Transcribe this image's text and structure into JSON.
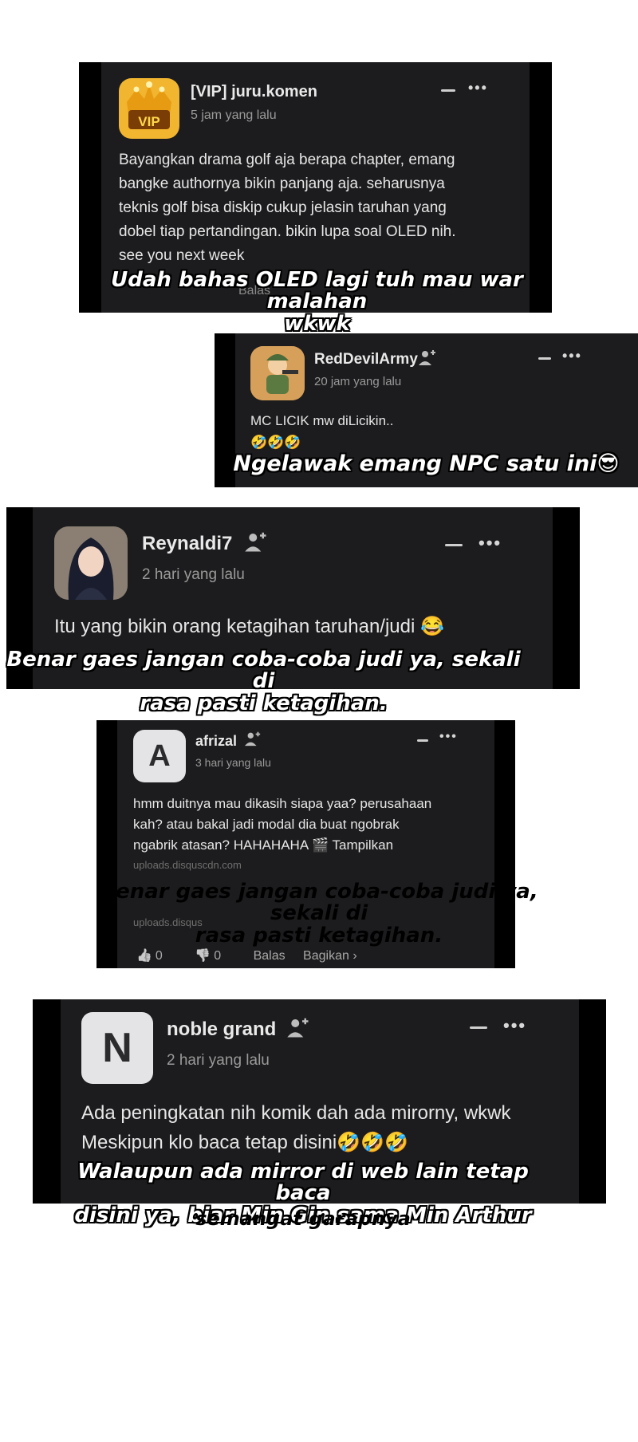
{
  "comments": [
    {
      "username": "[VIP] juru.komen",
      "time": "5 jam yang lalu",
      "text": "Bayangkan drama golf aja berapa chapter, emang\nbangke authornya bikin panjang aja. seharusnya\nteknis golf bisa diskip cukup jelasin taruhan yang\ndobel tiap pertandingan. bikin lupa soal OLED nih.\nsee you next week",
      "avatar_text": "VIP",
      "partial_action": "Balas",
      "caption": "Udah bahas OLED lagi tuh mau war malahan\nwkwk"
    },
    {
      "username": "RedDevilArmy",
      "time": "20 jam yang lalu",
      "text": "MC LICIK mw diLicikin..\n🤣🤣🤣",
      "caption": "Ngelawak emang NPC satu ini😎"
    },
    {
      "username": "Reynaldi7",
      "time": "2 hari yang lalu",
      "text": "Itu yang bikin orang ketagihan taruhan/judi 😂",
      "caption": "Benar gaes jangan coba-coba judi ya, sekali di\nrasa pasti ketagihan."
    },
    {
      "username": "afrizal",
      "time": "3 hari yang lalu",
      "avatar_letter": "A",
      "text": "hmm duitnya mau dikasih siapa yaa? perusahaan\nkah? atau bakal jadi modal dia buat ngobrak\nngabrik atasan? HAHAHAHA 🎬 Tampilkan",
      "link1": "uploads.disquscdn.com",
      "link2": "uploads.disqus",
      "caption": "Benar gaes jangan coba-coba judi ya, sekali di\nrasa pasti ketagihan.",
      "actions": {
        "like_count": "0",
        "dislike_count": "0",
        "reply": "Balas",
        "share": "Bagikan ›"
      }
    },
    {
      "username": "noble grand",
      "time": "2 hari yang lalu",
      "avatar_letter": "N",
      "text": "Ada peningkatan nih komik dah ada mirorny, wkwk\nMeskipun klo baca tetap disini🤣🤣🤣",
      "caption": "Walaupun ada mirror di web lain tetap baca\ndisini ya, biar Min Gin sama Min Arthur",
      "caption_tail": "semangat garapnya"
    }
  ],
  "icons": {
    "more": "•••",
    "like": "👍",
    "dislike": "👎",
    "follow": "person-plus-icon"
  },
  "colors": {
    "card_bg": "#1c1c1e",
    "card_outer": "#000000",
    "page_bg": "#ffffff"
  }
}
